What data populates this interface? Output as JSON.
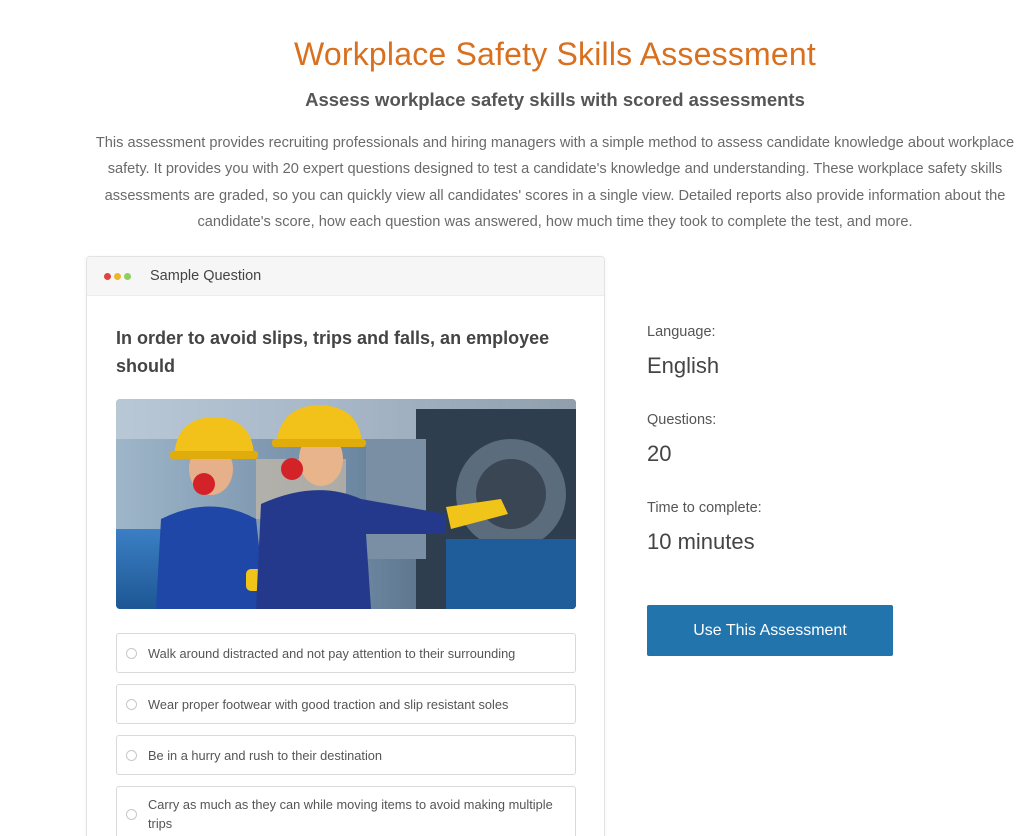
{
  "header": {
    "title": "Workplace Safety Skills Assessment",
    "subtitle": "Assess workplace safety skills with scored assessments",
    "description": "This assessment provides recruiting professionals and hiring managers with a simple method to assess candidate knowledge about workplace safety. It provides you with 20 expert questions designed to test a candidate's knowledge and understanding. These workplace safety skills assessments are graded, so you can quickly view all candidates' scores in a single view. Detailed reports also provide information about the candidate's score, how each question was answered, how much time they took to complete the test, and more."
  },
  "colors": {
    "title": "#d8701f",
    "button": "#2274ad",
    "window_dots": [
      "#e0443e",
      "#f0b62b",
      "#8fcf5c"
    ]
  },
  "sample_question": {
    "header_label": "Sample Question",
    "question": "In order to avoid slips, trips and falls, an employee should",
    "image": "photo of two workers in yellow hard hats and ear protection in a factory",
    "options": [
      "Walk around distracted and not pay attention to their surrounding",
      "Wear proper footwear with good traction and slip resistant soles",
      "Be in a hurry and rush to their destination",
      "Carry as much as they can while moving items to avoid making multiple trips"
    ]
  },
  "details": {
    "language_label": "Language:",
    "language_value": "English",
    "questions_label": "Questions:",
    "questions_value": "20",
    "time_label": "Time to complete:",
    "time_value": "10 minutes"
  },
  "cta": {
    "label": "Use This Assessment"
  }
}
